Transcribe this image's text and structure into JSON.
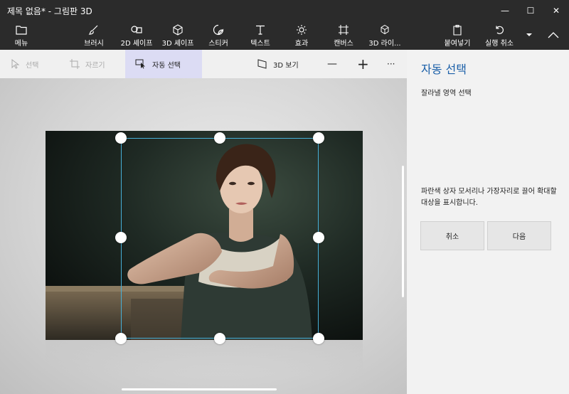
{
  "window": {
    "title": "제목 없음* - 그림판 3D",
    "controls": {
      "minimize": "—",
      "maximize": "☐",
      "close": "✕"
    }
  },
  "ribbon": {
    "menu": "메뉴",
    "tools": [
      {
        "label": "브러시",
        "icon": "brush-icon"
      },
      {
        "label": "2D 셰이프",
        "icon": "2d-shapes-icon"
      },
      {
        "label": "3D 셰이프",
        "icon": "3d-shapes-icon"
      },
      {
        "label": "스티커",
        "icon": "stickers-icon"
      },
      {
        "label": "텍스트",
        "icon": "text-icon"
      },
      {
        "label": "효과",
        "icon": "effects-icon"
      },
      {
        "label": "캔버스",
        "icon": "canvas-icon"
      },
      {
        "label": "3D 라이...",
        "icon": "3d-library-icon"
      }
    ],
    "paste": "붙여넣기",
    "undo": "실행 취소"
  },
  "subbar": {
    "select": "선택",
    "crop": "자르기",
    "magic_select": "자동 선택",
    "view3d": "3D 보기",
    "zoom_out": "—",
    "zoom_in": "+",
    "more": "···"
  },
  "panel": {
    "title": "자동 선택",
    "subtitle": "잘라낼 영역 선택",
    "description": "파란색 상자 모서리나 가장자리로 끌어 확대할 대상을 표시합니다.",
    "cancel": "취소",
    "next": "다음"
  },
  "colors": {
    "accent": "#1a5fa8",
    "selection": "#47b0d8",
    "active_tab": "#dcdcf4"
  }
}
